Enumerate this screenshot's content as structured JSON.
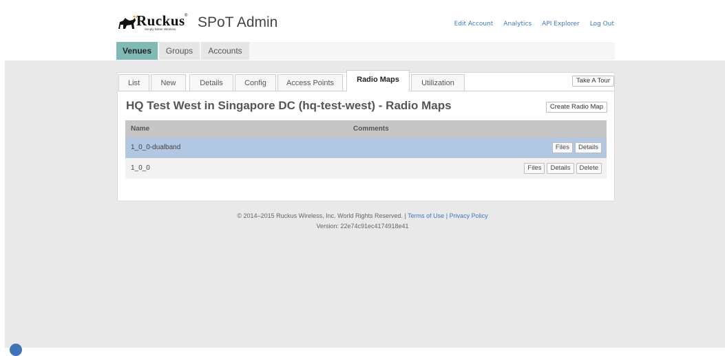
{
  "brand": {
    "logo_word": "Ruckus",
    "logo_reg": "®",
    "logo_tagline": "Simply Better Wireless.",
    "app_title": "SPoT Admin"
  },
  "top_links": [
    "Edit Account",
    "Analytics",
    "API Explorer",
    "Log Out"
  ],
  "main_nav": [
    {
      "label": "Venues",
      "active": true
    },
    {
      "label": "Groups",
      "active": false
    },
    {
      "label": "Accounts",
      "active": false
    }
  ],
  "tabs": [
    {
      "label": "List"
    },
    {
      "label": "New"
    },
    {
      "label": "Details"
    },
    {
      "label": "Config"
    },
    {
      "label": "Access Points"
    },
    {
      "label": "Radio Maps",
      "active": true
    },
    {
      "label": "Utilization"
    }
  ],
  "take_tour_label": "Take A Tour",
  "page_heading": "HQ Test West in Singapore DC (hq-test-west) - Radio Maps",
  "create_button_label": "Create Radio Map",
  "table": {
    "columns": [
      "Name",
      "Comments"
    ],
    "rows": [
      {
        "name": "1_0_0-dualband",
        "comments": "",
        "actions": [
          "Files",
          "Details"
        ],
        "selected": true
      },
      {
        "name": "1_0_0",
        "comments": "",
        "actions": [
          "Files",
          "Details",
          "Delete"
        ],
        "selected": false
      }
    ]
  },
  "footer": {
    "copyright": "© 2014–2015 Ruckus Wireless, Inc. World Rights Reserved. |",
    "terms": "Terms of Use",
    "separator": "|",
    "privacy": "Privacy Policy",
    "version": "Version: 22e74c91ec4174918e41"
  },
  "colors": {
    "accent_nav": "#7fbab4",
    "link": "#3a78c5",
    "selected_row": "#b2c7e1"
  }
}
